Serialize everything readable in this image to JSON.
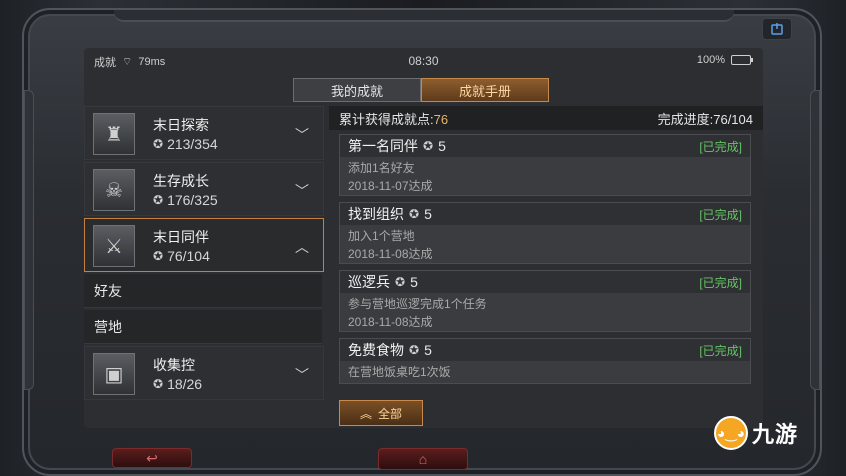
{
  "status_bar": {
    "carrier": "成就",
    "ping": "79ms",
    "time": "08:30",
    "battery": "100%",
    "battery_level": 1.0
  },
  "tabs": [
    {
      "label": "我的成就",
      "active": false
    },
    {
      "label": "成就手册",
      "active": true
    }
  ],
  "categories": [
    {
      "name": "末日探索",
      "count": "213/354",
      "icon": "tower-icon",
      "open": false
    },
    {
      "name": "生存成长",
      "count": "176/325",
      "icon": "skull-warrior-icon",
      "open": false
    },
    {
      "name": "末日同伴",
      "count": "76/104",
      "icon": "companions-icon",
      "open": true
    },
    {
      "name": "收集控",
      "count": "18/26",
      "icon": "chest-icon",
      "open": false
    }
  ],
  "sub_items": [
    "好友",
    "营地"
  ],
  "summary": {
    "label": "累计获得成就点:",
    "points": "76",
    "progress_label": "完成进度:",
    "progress": "76/104"
  },
  "cards": [
    {
      "title": "第一名同伴",
      "points": "5",
      "status": "[已完成]",
      "desc": "添加1名好友",
      "date": "2018-11-07达成"
    },
    {
      "title": "找到组织",
      "points": "5",
      "status": "[已完成]",
      "desc": "加入1个营地",
      "date": "2018-11-08达成"
    },
    {
      "title": "巡逻兵",
      "points": "5",
      "status": "[已完成]",
      "desc": "参与营地巡逻完成1个任务",
      "date": "2018-11-08达成"
    },
    {
      "title": "免费食物",
      "points": "5",
      "status": "[已完成]",
      "desc": "在营地饭桌吃1次饭",
      "date": ""
    }
  ],
  "all_button": "全部",
  "watermark": "九游",
  "colors": {
    "accent": "#c8894a",
    "completed": "#66c466"
  }
}
